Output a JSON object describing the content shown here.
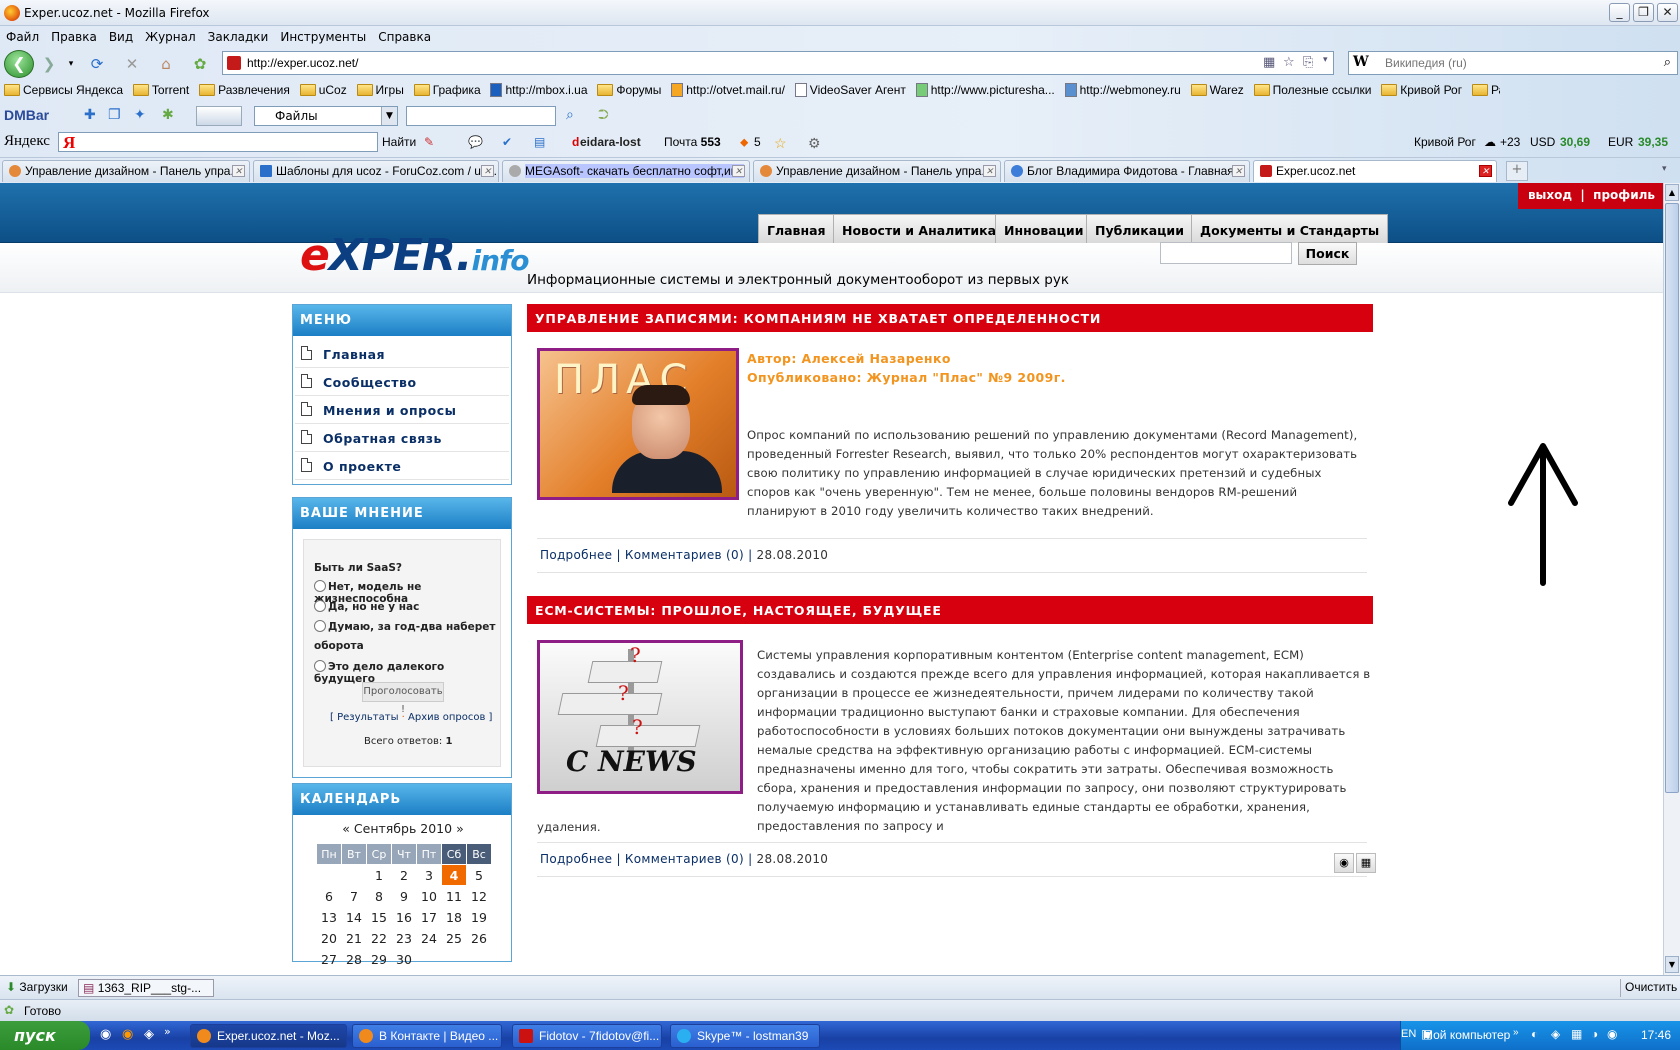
{
  "window": {
    "title": "Exper.ucoz.net - Mozilla Firefox"
  },
  "menu": [
    "Файл",
    "Правка",
    "Вид",
    "Журнал",
    "Закладки",
    "Инструменты",
    "Справка"
  ],
  "nav": {
    "url": "http://exper.ucoz.net/",
    "search_placeholder": "Википедия (ru)"
  },
  "bookmarks": [
    "Сервисы Яндекса",
    "Torrent",
    "Развлечения",
    "uCoz",
    "Игры",
    "Графика",
    "http://mbox.i.ua",
    "Форумы",
    "http://otvet.mail.ru/",
    "VideoSaver Агент",
    "http://www.picturesha...",
    "http://webmoney.ru",
    "Warez",
    "Полезные ссылки",
    "Кривой Рог",
    "Работа"
  ],
  "dmbar": {
    "label": "DMBar",
    "combo": "Файлы"
  },
  "yabar": {
    "label": "Яндекс",
    "find": "Найти",
    "user": "deidara-lost",
    "mail": "Почта",
    "mail_count": "553",
    "five": "5",
    "city": "Кривой Рог",
    "temp": "+23",
    "usd_label": "USD",
    "usd": "30,69",
    "eur_label": "EUR",
    "eur": "39,35"
  },
  "tabs": [
    "Управление дизайном - Панель упра...",
    "Шаблоны для ucoz - ForuCoz.com / uc...",
    "MEGAsoft- скачать бесплатно софт,иг...",
    "Управление дизайном - Панель упра...",
    "Блог Владимира Фидотова - Главная...",
    "Exper.ucoz.net"
  ],
  "site": {
    "exit": "выход",
    "sep": "|",
    "profile": "профиль",
    "nav": [
      "Главная",
      "Новости и Аналитика",
      "Инновации",
      "Публикации",
      "Документы и Стандарты"
    ],
    "logo_e": "e",
    "logo_rest": "XPER.",
    "logo_info": "info",
    "tagline": "Информационные системы и электронный документооборот из первых рук",
    "search_btn": "Поиск",
    "menu_title": "МЕНЮ",
    "menu": [
      "Главная",
      "Сообщество",
      "Мнения и опросы",
      "Обратная связь",
      "О проекте"
    ],
    "poll_title": "ВАШЕ МНЕНИЕ",
    "poll": {
      "question": "Быть ли SaaS?",
      "options": [
        "Нет, модель не жизнеспособна",
        "Да, но не у нас",
        "Думаю, за год-два наберет",
        "оборота",
        "Это дело далекого будущего"
      ],
      "vote": "Проголосовать !",
      "results": "Результаты",
      "archive": "Архив опросов",
      "total_label": "Всего ответов:",
      "total": "1"
    },
    "cal_title": "КАЛЕНДАРЬ",
    "calendar": {
      "month": "«  Сентябрь 2010  »",
      "weekdays": [
        "Пн",
        "Вт",
        "Ср",
        "Чт",
        "Пт",
        "Сб",
        "Вс"
      ],
      "rows": [
        [
          "",
          "",
          "1",
          "2",
          "3",
          "4",
          "5"
        ],
        [
          "6",
          "7",
          "8",
          "9",
          "10",
          "11",
          "12"
        ],
        [
          "13",
          "14",
          "15",
          "16",
          "17",
          "18",
          "19"
        ],
        [
          "20",
          "21",
          "22",
          "23",
          "24",
          "25",
          "26"
        ],
        [
          "27",
          "28",
          "29",
          "30",
          "",
          "",
          ""
        ]
      ],
      "today": "4"
    },
    "articles": [
      {
        "title": "УПРАВЛЕНИЕ ЗАПИСЯМИ: КОМПАНИЯМ НЕ ХВАТАЕТ ОПРЕДЕЛЕННОСТИ",
        "author": "Автор: Алексей Назаренко",
        "published": "Опубликовано: Журнал \"Плас\" №9 2009г.",
        "body": "Опрос компаний по использованию решений по управлению документами (Record Management), проведенный Forrester Research, выявил, что только 20% респондентов могут охарактеризовать свою политику по управлению информацией в случае юридических претензий и судебных споров как \"очень уверенную\". Тем не менее, больше половины вендоров RM-решений планируют в 2010 году увеличить количество таких внедрений.",
        "more": "Подробнее",
        "comments": "Комментариев (0)",
        "date": "28.08.2010",
        "img_text": "ПЛАС"
      },
      {
        "title": "ECM-СИСТЕМЫ: ПРОШЛОЕ, НАСТОЯЩЕЕ, БУДУЩЕЕ",
        "body": "Системы управления корпоративным контентом (Enterprise content management, ECM) создавались и создаются прежде всего для управления информацией, которая накапливается в организации в процессе ее жизнедеятельности, причем лидерами по количеству такой информации традиционно выступают банки и страховые компании. Для обеспечения работоспособности в условиях больших потоков документации они вынуждены затрачивать немалые средства на эффективную организацию работы с информацией. ECM-системы предназначены именно для того, чтобы сократить эти затраты. Обеспечивая возможность сбора, хранения и предоставления информации по запросу, они позволяют структурировать получаемую информацию и устанавливать единые стандарты ее обработки, хранения, предоставления по запросу и",
        "body_tail": "удаления.",
        "more": "Подробнее",
        "comments": "Комментариев (0)",
        "date": "28.08.2010",
        "img_text": "C NEWS"
      }
    ]
  },
  "downloads": {
    "label": "Загрузки",
    "file": "1363_RIP___stg-...",
    "clear": "Очистить"
  },
  "status": "Готово",
  "taskbar": {
    "start": "пуск",
    "items": [
      "Exper.ucoz.net - Moz...",
      "В Контакте | Видео ...",
      "Fidotov - 7fidotov@fi...",
      "Skype™ - lostman39"
    ],
    "lang": "EN",
    "mycomp": "Мой компьютер",
    "clock": "17:46"
  }
}
